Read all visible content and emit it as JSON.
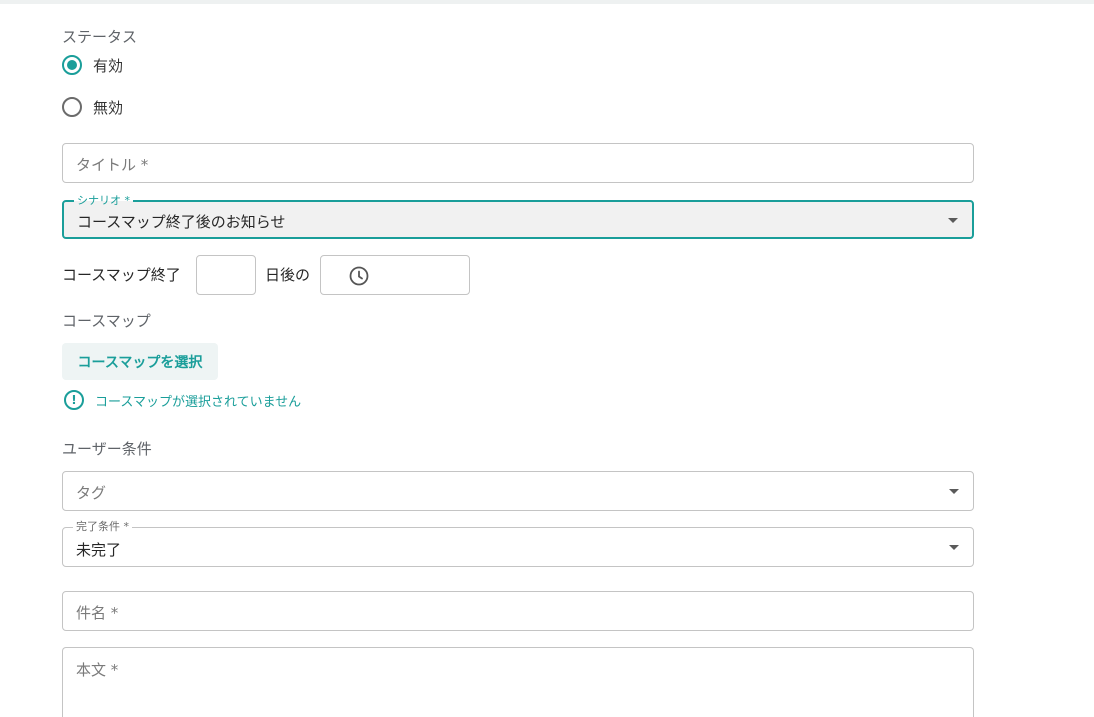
{
  "status": {
    "label": "ステータス",
    "options": [
      {
        "label": "有効",
        "checked": true
      },
      {
        "label": "無効",
        "checked": false
      }
    ]
  },
  "title_field": {
    "placeholder": "タイトル *",
    "value": ""
  },
  "scenario": {
    "label": "シナリオ *",
    "value": "コースマップ終了後のお知らせ"
  },
  "timing": {
    "prefix": "コースマップ終了",
    "days_value": "",
    "middle": "日後の",
    "time_value": "",
    "time_icon": "clock-icon"
  },
  "coursemap": {
    "label": "コースマップ",
    "select_button": "コースマップを選択",
    "warning": "コースマップが選択されていません",
    "warning_icon": "alert-circle-icon"
  },
  "user_conditions": {
    "label": "ユーザー条件",
    "tag_placeholder": "タグ",
    "completion": {
      "label": "完了条件 *",
      "value": "未完了"
    }
  },
  "subject_field": {
    "placeholder": "件名 *",
    "value": ""
  },
  "body_field": {
    "placeholder": "本文 *",
    "value": ""
  },
  "colors": {
    "accent": "#1a9e9a",
    "border": "#c4c4c4",
    "select_bg": "#f1f1f1"
  }
}
